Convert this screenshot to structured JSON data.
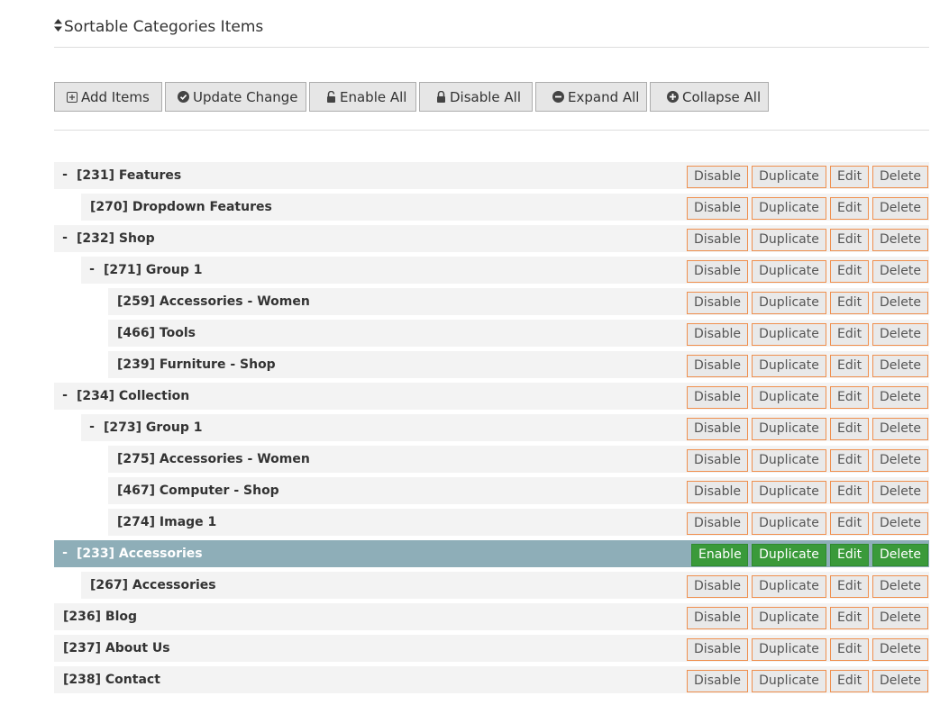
{
  "header": {
    "title": "Sortable Categories Items",
    "icon": "sort-icon"
  },
  "toolbar": {
    "add_label": "Add Items",
    "update_label": "Update Change",
    "enable_all_label": "Enable All",
    "disable_all_label": "Disable All",
    "expand_all_label": "Expand All",
    "collapse_all_label": "Collapse All"
  },
  "colors": {
    "selected_row": "#8eaeb8",
    "enabled_action": "#3a9a3a",
    "action_border": "#ef8f4e"
  },
  "tree": [
    {
      "label": "[231] Features",
      "level": 0,
      "toggle": "-",
      "status_action": "Disable",
      "selected": false
    },
    {
      "label": "[270] Dropdown Features",
      "level": 1,
      "toggle": "",
      "status_action": "Disable",
      "selected": false
    },
    {
      "label": "[232] Shop",
      "level": 0,
      "toggle": "-",
      "status_action": "Disable",
      "selected": false
    },
    {
      "label": "[271] Group 1",
      "level": 1,
      "toggle": "-",
      "status_action": "Disable",
      "selected": false
    },
    {
      "label": "[259] Accessories - Women",
      "level": 2,
      "toggle": "",
      "status_action": "Disable",
      "selected": false
    },
    {
      "label": "[466] Tools",
      "level": 2,
      "toggle": "",
      "status_action": "Disable",
      "selected": false
    },
    {
      "label": "[239] Furniture - Shop",
      "level": 2,
      "toggle": "",
      "status_action": "Disable",
      "selected": false
    },
    {
      "label": "[234] Collection",
      "level": 0,
      "toggle": "-",
      "status_action": "Disable",
      "selected": false
    },
    {
      "label": "[273] Group 1",
      "level": 1,
      "toggle": "-",
      "status_action": "Disable",
      "selected": false
    },
    {
      "label": "[275] Accessories - Women",
      "level": 2,
      "toggle": "",
      "status_action": "Disable",
      "selected": false
    },
    {
      "label": "[467] Computer - Shop",
      "level": 2,
      "toggle": "",
      "status_action": "Disable",
      "selected": false
    },
    {
      "label": "[274] Image 1",
      "level": 2,
      "toggle": "",
      "status_action": "Disable",
      "selected": false
    },
    {
      "label": "[233] Accessories",
      "level": 0,
      "toggle": "-",
      "status_action": "Enable",
      "selected": true
    },
    {
      "label": "[267] Accessories",
      "level": 1,
      "toggle": "",
      "status_action": "Disable",
      "selected": false
    },
    {
      "label": "[236] Blog",
      "level": 0,
      "toggle": "",
      "status_action": "Disable",
      "selected": false
    },
    {
      "label": "[237] About Us",
      "level": 0,
      "toggle": "",
      "status_action": "Disable",
      "selected": false
    },
    {
      "label": "[238] Contact",
      "level": 0,
      "toggle": "",
      "status_action": "Disable",
      "selected": false
    }
  ],
  "row_actions": {
    "duplicate": "Duplicate",
    "edit": "Edit",
    "delete": "Delete"
  }
}
